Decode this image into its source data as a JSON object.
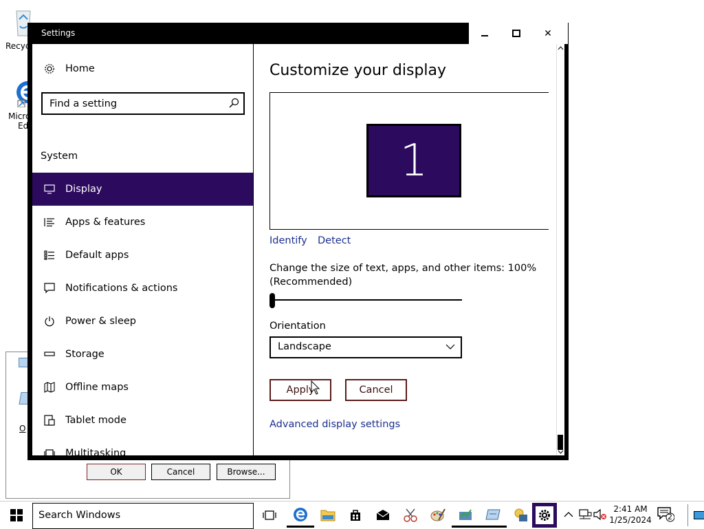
{
  "desktop": {
    "icons": [
      {
        "label": "Recycle Bin",
        "visible_label": "Recyc"
      },
      {
        "label": "Microsoft Edge",
        "visible_label_1": "Micro",
        "visible_label_2": "Ed"
      }
    ]
  },
  "background_dialog": {
    "ok_label": "OK",
    "cancel_label": "Cancel",
    "browse_label": "Browse...",
    "partial_label": "O"
  },
  "window": {
    "title": "Settings",
    "minimize_glyph": "—",
    "maximize_glyph": "□",
    "close_glyph": "✕"
  },
  "sidebar": {
    "home_label": "Home",
    "search_placeholder": "Find a setting",
    "section_label": "System",
    "items": [
      {
        "label": "Display",
        "icon": "monitor-icon",
        "active": true
      },
      {
        "label": "Apps & features",
        "icon": "list-icon"
      },
      {
        "label": "Default apps",
        "icon": "default-apps-icon"
      },
      {
        "label": "Notifications & actions",
        "icon": "notification-icon"
      },
      {
        "label": "Power & sleep",
        "icon": "power-icon"
      },
      {
        "label": "Storage",
        "icon": "storage-icon"
      },
      {
        "label": "Offline maps",
        "icon": "map-icon"
      },
      {
        "label": "Tablet mode",
        "icon": "tablet-icon"
      },
      {
        "label": "Multitasking",
        "icon": "multitasking-icon"
      }
    ]
  },
  "main": {
    "heading": "Customize your display",
    "monitor_number": "1",
    "identify_label": "Identify",
    "detect_label": "Detect",
    "scale_text": "Change the size of text, apps, and other items: 100%",
    "scale_text_2": "(Recommended)",
    "scale_value": 0,
    "orientation_label": "Orientation",
    "orientation_value": "Landscape",
    "apply_label": "Apply",
    "cancel_label": "Cancel",
    "advanced_label": "Advanced display settings"
  },
  "taskbar": {
    "search_placeholder": "Search Windows",
    "time": "2:41 AM",
    "date": "1/25/2024",
    "notification_count": "2"
  },
  "colors": {
    "accent": "#2c0a5e",
    "link": "#1b2f8e",
    "button_border": "#5a1a1a"
  }
}
